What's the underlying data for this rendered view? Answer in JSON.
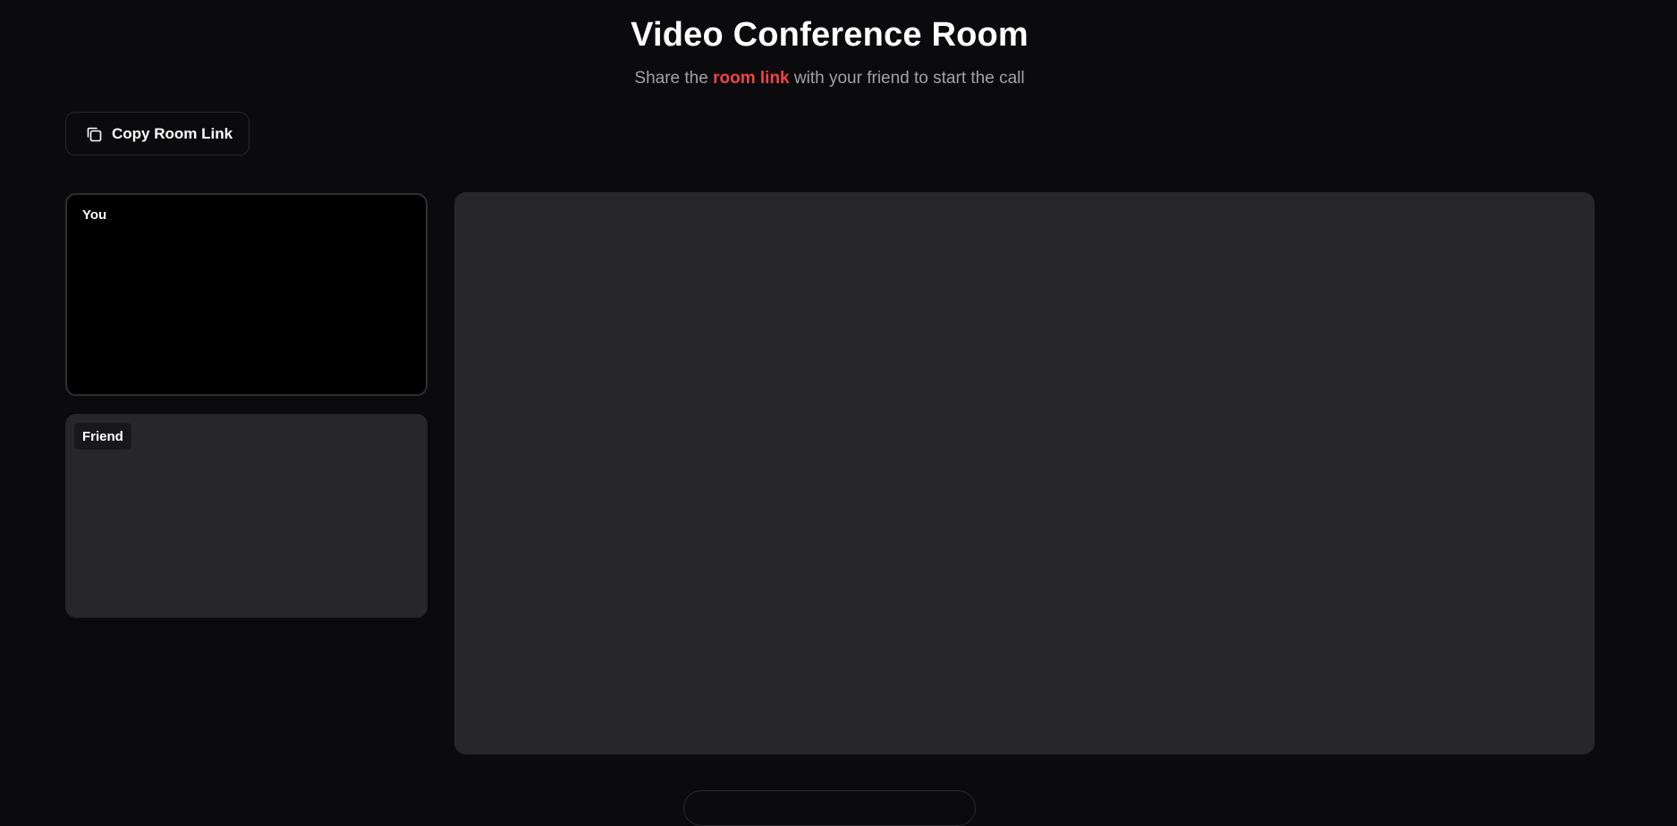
{
  "header": {
    "title": "Video Conference Room",
    "subtitle_prefix": "Share the",
    "subtitle_highlight": "room link",
    "subtitle_suffix": "with your friend to start the call"
  },
  "toolbar": {
    "copy_label": "Copy Room Link",
    "copy_icon": "copy-icon"
  },
  "participants": {
    "you_label": "You",
    "friend_label": "Friend"
  },
  "colors": {
    "background": "#0b0b0d",
    "panel": "#27272a",
    "accent": "#ef4444",
    "muted_text": "#a1a1aa"
  }
}
